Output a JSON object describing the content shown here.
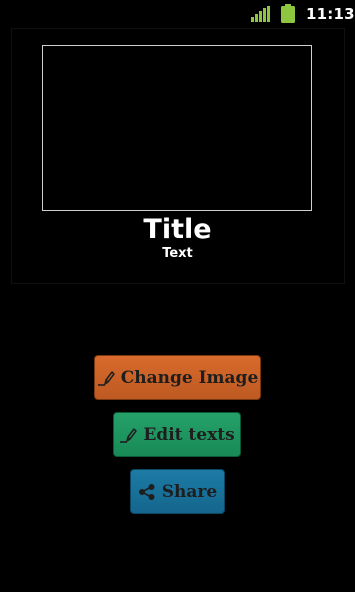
{
  "status_bar": {
    "time": "11:13",
    "signal_icon": "signal-bars-icon",
    "battery_icon": "battery-icon",
    "accent_color": "#8ec63f"
  },
  "card": {
    "title": "Title",
    "subtitle": "Text",
    "frame_color": "#cfcfcf"
  },
  "buttons": {
    "change_image": {
      "label": "Change Image",
      "icon": "pencil-icon",
      "color": "#c95f26"
    },
    "edit_texts": {
      "label": "Edit texts",
      "icon": "pencil-icon",
      "color": "#1c9460"
    },
    "share": {
      "label": "Share",
      "icon": "share-icon",
      "color": "#176f98"
    }
  }
}
